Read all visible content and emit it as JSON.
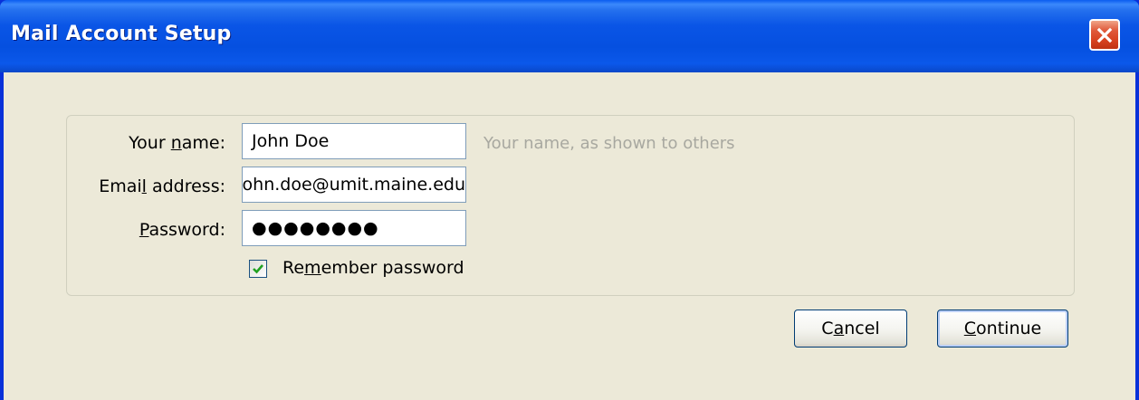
{
  "window": {
    "title": "Mail Account Setup",
    "close_icon": "close-x-icon"
  },
  "form": {
    "name_label_pre": "Your ",
    "name_label_key": "n",
    "name_label_post": "ame:",
    "name_value": "John Doe",
    "name_hint": "Your name, as shown to others",
    "email_label_pre": "Emai",
    "email_label_key": "l",
    "email_label_post": " address:",
    "email_value": "john.doe@umit.maine.edu",
    "password_label_key": "P",
    "password_label_post": "assword:",
    "password_value": "●●●●●●●●",
    "remember_label_pre": "Re",
    "remember_label_key": "m",
    "remember_label_post": "ember password",
    "remember_checked": true
  },
  "buttons": {
    "cancel_pre": "C",
    "cancel_key": "a",
    "cancel_post": "ncel",
    "continue_key": "C",
    "continue_post": "ontinue"
  },
  "colors": {
    "titlebar": "#0550e0",
    "dialog_bg": "#ece9d8",
    "close_button": "#d7421f",
    "check_mark": "#21a121",
    "hint_text": "#a8a8a0"
  }
}
